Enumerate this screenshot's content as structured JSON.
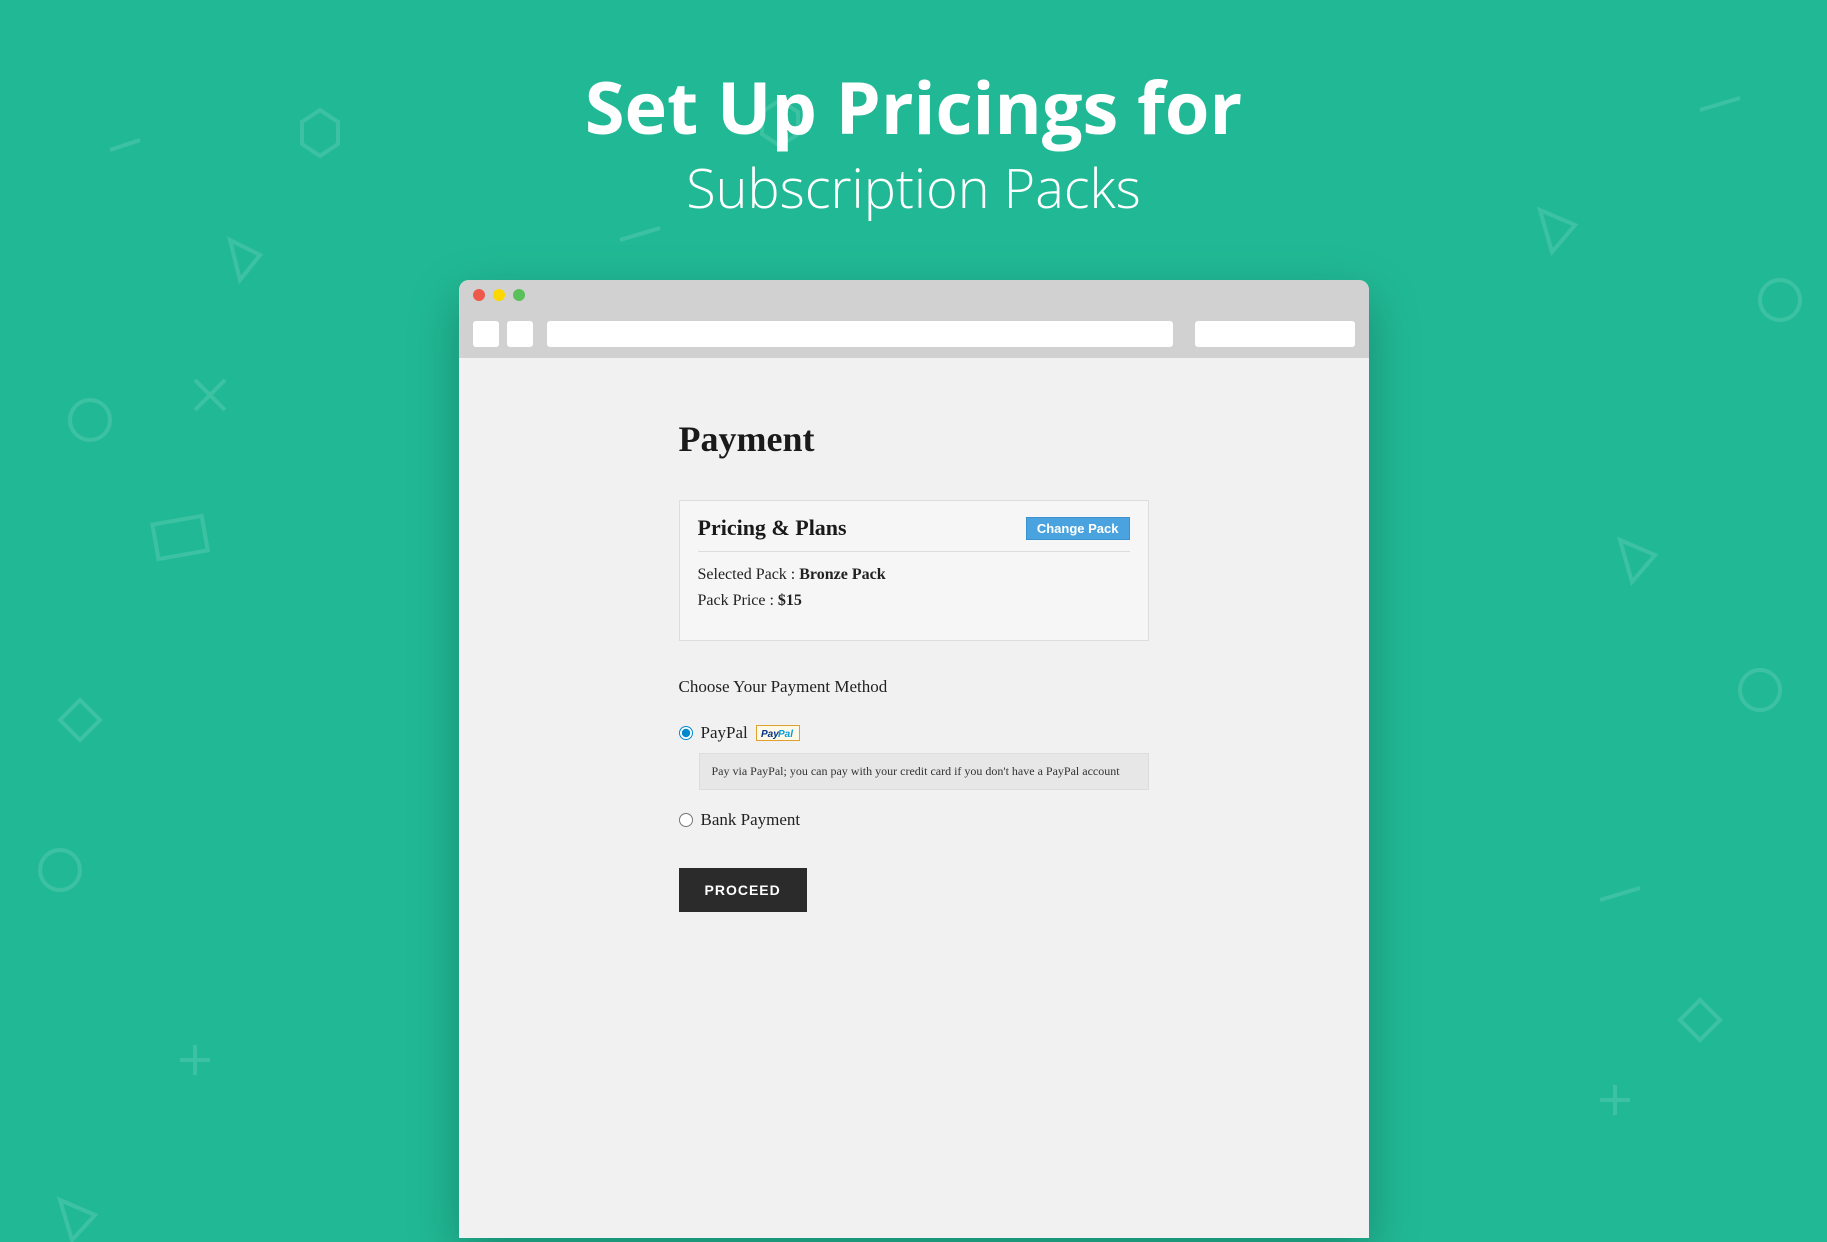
{
  "hero": {
    "title": "Set Up Pricings for",
    "subtitle": "Subscription Packs"
  },
  "page": {
    "title": "Payment",
    "card": {
      "title": "Pricing & Plans",
      "change_label": "Change Pack",
      "selected_label": "Selected Pack : ",
      "selected_value": "Bronze Pack",
      "price_label": "Pack Price : ",
      "price_value": "$15"
    },
    "method_label": "Choose Your Payment Method",
    "paypal": {
      "label": "PayPal",
      "badge": "PayPal",
      "desc": "Pay via PayPal; you can pay with your credit card if you don't have a PayPal account"
    },
    "bank": {
      "label": "Bank Payment"
    },
    "proceed": "PROCEED"
  }
}
